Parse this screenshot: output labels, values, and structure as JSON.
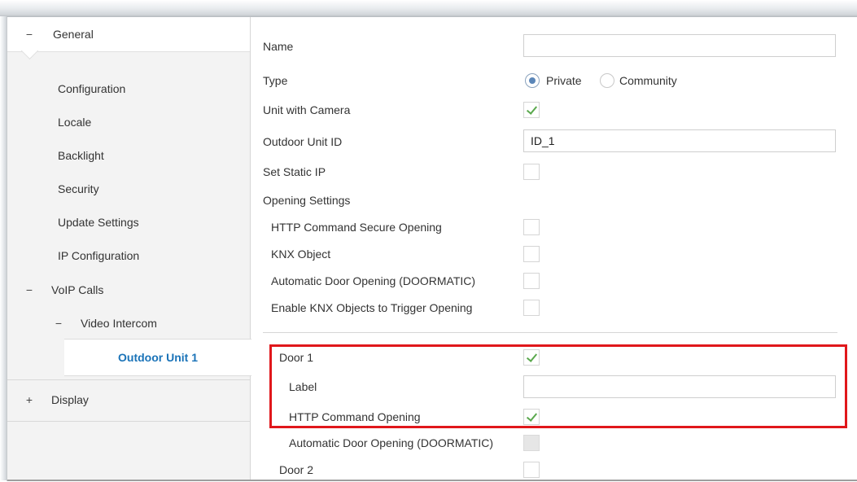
{
  "sidebar": {
    "general": {
      "toggle": "−",
      "label": "General"
    },
    "general_items": [
      {
        "label": "Configuration"
      },
      {
        "label": "Locale"
      },
      {
        "label": "Backlight"
      },
      {
        "label": "Security"
      },
      {
        "label": "Update Settings"
      },
      {
        "label": "IP Configuration"
      }
    ],
    "voip": {
      "toggle": "−",
      "label": "VoIP Calls"
    },
    "video_intercom": {
      "toggle": "−",
      "label": "Video Intercom"
    },
    "selected_item": {
      "label": "Outdoor Unit 1"
    },
    "display": {
      "toggle": "+",
      "label": "Display"
    }
  },
  "form": {
    "name": {
      "label": "Name",
      "value": ""
    },
    "type": {
      "label": "Type",
      "options": [
        {
          "label": "Private",
          "selected": true
        },
        {
          "label": "Community",
          "selected": false
        }
      ]
    },
    "unit_with_camera": {
      "label": "Unit with Camera",
      "checked": true
    },
    "outdoor_unit_id": {
      "label": "Outdoor Unit ID",
      "value": "ID_1"
    },
    "set_static_ip": {
      "label": "Set Static IP",
      "checked": false
    },
    "opening_settings": {
      "label": "Opening Settings",
      "items": [
        {
          "label": "HTTP Command Secure Opening",
          "checked": false
        },
        {
          "label": "KNX Object",
          "checked": false
        },
        {
          "label": "Automatic Door Opening (DOORMATIC)",
          "checked": false
        },
        {
          "label": "Enable KNX Objects to Trigger Opening",
          "checked": false
        }
      ]
    },
    "door1": {
      "label": "Door 1",
      "checked": true,
      "label_field": {
        "label": "Label",
        "value": ""
      },
      "http_command_opening": {
        "label": "HTTP Command Opening",
        "checked": true
      },
      "doormatic": {
        "label": "Automatic Door Opening (DOORMATIC)",
        "checked": false,
        "disabled": true
      }
    },
    "door2": {
      "label": "Door 2",
      "checked": false
    }
  },
  "colors": {
    "accent": "#1a73b8",
    "highlight": "#e0171b",
    "check": "#5aa84d"
  }
}
